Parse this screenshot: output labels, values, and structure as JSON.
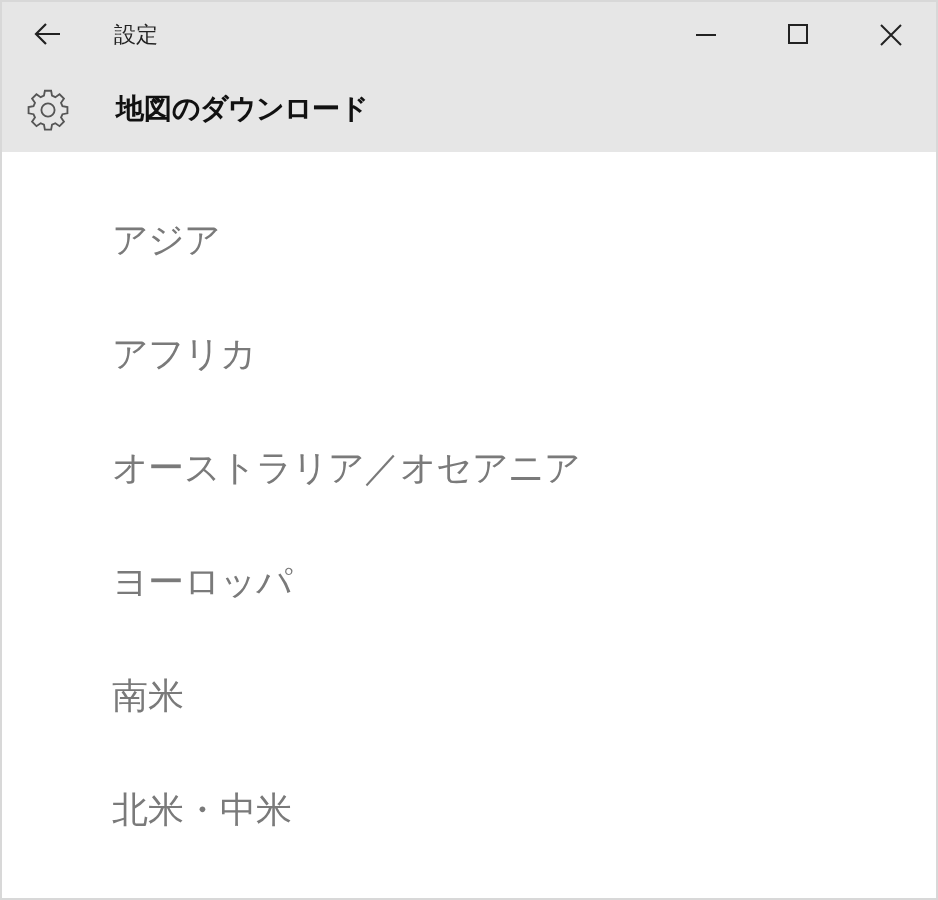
{
  "window": {
    "title": "設定"
  },
  "header": {
    "title": "地図のダウンロード"
  },
  "regions": [
    {
      "label": "アジア"
    },
    {
      "label": "アフリカ"
    },
    {
      "label": "オーストラリア／オセアニア"
    },
    {
      "label": "ヨーロッパ"
    },
    {
      "label": "南米"
    },
    {
      "label": "北米・中米"
    }
  ]
}
